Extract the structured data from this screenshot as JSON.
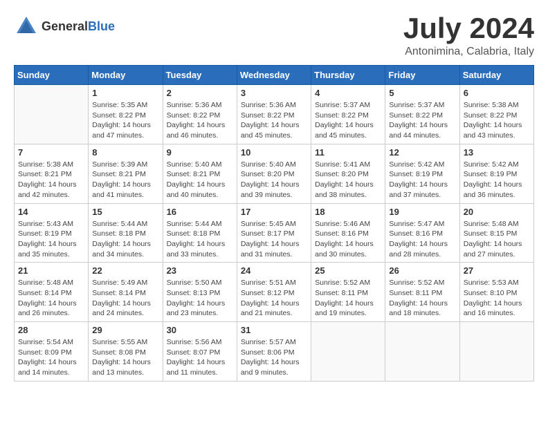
{
  "logo": {
    "general": "General",
    "blue": "Blue"
  },
  "header": {
    "month": "July 2024",
    "location": "Antonimina, Calabria, Italy"
  },
  "weekdays": [
    "Sunday",
    "Monday",
    "Tuesday",
    "Wednesday",
    "Thursday",
    "Friday",
    "Saturday"
  ],
  "weeks": [
    [
      {
        "day": "",
        "sunrise": "",
        "sunset": "",
        "daylight": ""
      },
      {
        "day": "1",
        "sunrise": "Sunrise: 5:35 AM",
        "sunset": "Sunset: 8:22 PM",
        "daylight": "Daylight: 14 hours and 47 minutes."
      },
      {
        "day": "2",
        "sunrise": "Sunrise: 5:36 AM",
        "sunset": "Sunset: 8:22 PM",
        "daylight": "Daylight: 14 hours and 46 minutes."
      },
      {
        "day": "3",
        "sunrise": "Sunrise: 5:36 AM",
        "sunset": "Sunset: 8:22 PM",
        "daylight": "Daylight: 14 hours and 45 minutes."
      },
      {
        "day": "4",
        "sunrise": "Sunrise: 5:37 AM",
        "sunset": "Sunset: 8:22 PM",
        "daylight": "Daylight: 14 hours and 45 minutes."
      },
      {
        "day": "5",
        "sunrise": "Sunrise: 5:37 AM",
        "sunset": "Sunset: 8:22 PM",
        "daylight": "Daylight: 14 hours and 44 minutes."
      },
      {
        "day": "6",
        "sunrise": "Sunrise: 5:38 AM",
        "sunset": "Sunset: 8:22 PM",
        "daylight": "Daylight: 14 hours and 43 minutes."
      }
    ],
    [
      {
        "day": "7",
        "sunrise": "Sunrise: 5:38 AM",
        "sunset": "Sunset: 8:21 PM",
        "daylight": "Daylight: 14 hours and 42 minutes."
      },
      {
        "day": "8",
        "sunrise": "Sunrise: 5:39 AM",
        "sunset": "Sunset: 8:21 PM",
        "daylight": "Daylight: 14 hours and 41 minutes."
      },
      {
        "day": "9",
        "sunrise": "Sunrise: 5:40 AM",
        "sunset": "Sunset: 8:21 PM",
        "daylight": "Daylight: 14 hours and 40 minutes."
      },
      {
        "day": "10",
        "sunrise": "Sunrise: 5:40 AM",
        "sunset": "Sunset: 8:20 PM",
        "daylight": "Daylight: 14 hours and 39 minutes."
      },
      {
        "day": "11",
        "sunrise": "Sunrise: 5:41 AM",
        "sunset": "Sunset: 8:20 PM",
        "daylight": "Daylight: 14 hours and 38 minutes."
      },
      {
        "day": "12",
        "sunrise": "Sunrise: 5:42 AM",
        "sunset": "Sunset: 8:19 PM",
        "daylight": "Daylight: 14 hours and 37 minutes."
      },
      {
        "day": "13",
        "sunrise": "Sunrise: 5:42 AM",
        "sunset": "Sunset: 8:19 PM",
        "daylight": "Daylight: 14 hours and 36 minutes."
      }
    ],
    [
      {
        "day": "14",
        "sunrise": "Sunrise: 5:43 AM",
        "sunset": "Sunset: 8:19 PM",
        "daylight": "Daylight: 14 hours and 35 minutes."
      },
      {
        "day": "15",
        "sunrise": "Sunrise: 5:44 AM",
        "sunset": "Sunset: 8:18 PM",
        "daylight": "Daylight: 14 hours and 34 minutes."
      },
      {
        "day": "16",
        "sunrise": "Sunrise: 5:44 AM",
        "sunset": "Sunset: 8:18 PM",
        "daylight": "Daylight: 14 hours and 33 minutes."
      },
      {
        "day": "17",
        "sunrise": "Sunrise: 5:45 AM",
        "sunset": "Sunset: 8:17 PM",
        "daylight": "Daylight: 14 hours and 31 minutes."
      },
      {
        "day": "18",
        "sunrise": "Sunrise: 5:46 AM",
        "sunset": "Sunset: 8:16 PM",
        "daylight": "Daylight: 14 hours and 30 minutes."
      },
      {
        "day": "19",
        "sunrise": "Sunrise: 5:47 AM",
        "sunset": "Sunset: 8:16 PM",
        "daylight": "Daylight: 14 hours and 28 minutes."
      },
      {
        "day": "20",
        "sunrise": "Sunrise: 5:48 AM",
        "sunset": "Sunset: 8:15 PM",
        "daylight": "Daylight: 14 hours and 27 minutes."
      }
    ],
    [
      {
        "day": "21",
        "sunrise": "Sunrise: 5:48 AM",
        "sunset": "Sunset: 8:14 PM",
        "daylight": "Daylight: 14 hours and 26 minutes."
      },
      {
        "day": "22",
        "sunrise": "Sunrise: 5:49 AM",
        "sunset": "Sunset: 8:14 PM",
        "daylight": "Daylight: 14 hours and 24 minutes."
      },
      {
        "day": "23",
        "sunrise": "Sunrise: 5:50 AM",
        "sunset": "Sunset: 8:13 PM",
        "daylight": "Daylight: 14 hours and 23 minutes."
      },
      {
        "day": "24",
        "sunrise": "Sunrise: 5:51 AM",
        "sunset": "Sunset: 8:12 PM",
        "daylight": "Daylight: 14 hours and 21 minutes."
      },
      {
        "day": "25",
        "sunrise": "Sunrise: 5:52 AM",
        "sunset": "Sunset: 8:11 PM",
        "daylight": "Daylight: 14 hours and 19 minutes."
      },
      {
        "day": "26",
        "sunrise": "Sunrise: 5:52 AM",
        "sunset": "Sunset: 8:11 PM",
        "daylight": "Daylight: 14 hours and 18 minutes."
      },
      {
        "day": "27",
        "sunrise": "Sunrise: 5:53 AM",
        "sunset": "Sunset: 8:10 PM",
        "daylight": "Daylight: 14 hours and 16 minutes."
      }
    ],
    [
      {
        "day": "28",
        "sunrise": "Sunrise: 5:54 AM",
        "sunset": "Sunset: 8:09 PM",
        "daylight": "Daylight: 14 hours and 14 minutes."
      },
      {
        "day": "29",
        "sunrise": "Sunrise: 5:55 AM",
        "sunset": "Sunset: 8:08 PM",
        "daylight": "Daylight: 14 hours and 13 minutes."
      },
      {
        "day": "30",
        "sunrise": "Sunrise: 5:56 AM",
        "sunset": "Sunset: 8:07 PM",
        "daylight": "Daylight: 14 hours and 11 minutes."
      },
      {
        "day": "31",
        "sunrise": "Sunrise: 5:57 AM",
        "sunset": "Sunset: 8:06 PM",
        "daylight": "Daylight: 14 hours and 9 minutes."
      },
      {
        "day": "",
        "sunrise": "",
        "sunset": "",
        "daylight": ""
      },
      {
        "day": "",
        "sunrise": "",
        "sunset": "",
        "daylight": ""
      },
      {
        "day": "",
        "sunrise": "",
        "sunset": "",
        "daylight": ""
      }
    ]
  ]
}
